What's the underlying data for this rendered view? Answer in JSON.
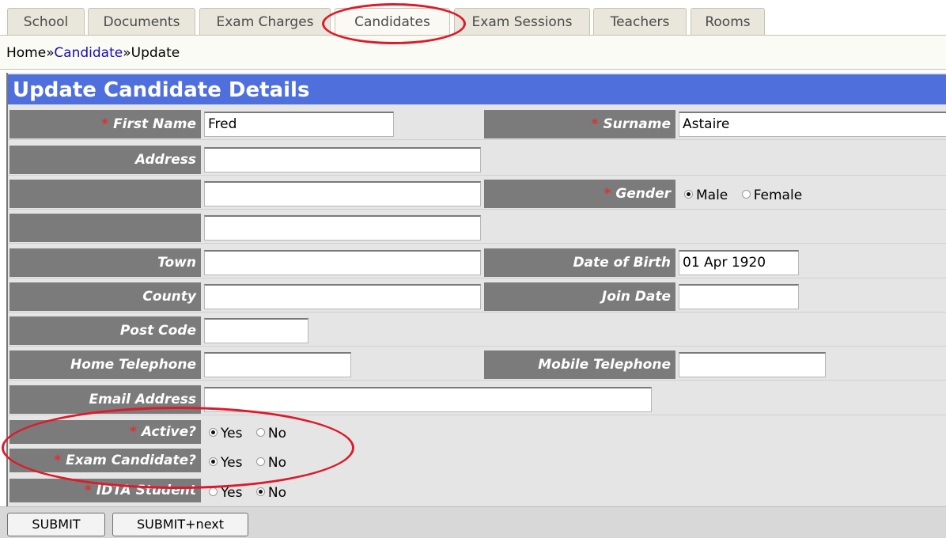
{
  "tabs": [
    {
      "label": "School"
    },
    {
      "label": "Documents"
    },
    {
      "label": "Exam Charges"
    },
    {
      "label": "Candidates",
      "active": true
    },
    {
      "label": "Exam Sessions"
    },
    {
      "label": "Teachers"
    },
    {
      "label": "Rooms"
    }
  ],
  "breadcrumb": {
    "home": "Home",
    "sep1": "»",
    "candidate": "Candidate",
    "sep2": "»",
    "update": "Update"
  },
  "form": {
    "title": "Update Candidate Details",
    "required_mark": "*",
    "first_name": {
      "label": "First Name",
      "value": "Fred"
    },
    "surname": {
      "label": "Surname",
      "value": "Astaire"
    },
    "address": {
      "label": "Address",
      "line1": "",
      "line2": "",
      "line3": ""
    },
    "gender": {
      "label": "Gender",
      "options": [
        "Male",
        "Female"
      ],
      "selected": "Male"
    },
    "town": {
      "label": "Town",
      "value": ""
    },
    "date_of_birth": {
      "label": "Date of Birth",
      "value": "01 Apr 1920"
    },
    "county": {
      "label": "County",
      "value": ""
    },
    "join_date": {
      "label": "Join Date",
      "value": ""
    },
    "post_code": {
      "label": "Post Code",
      "value": ""
    },
    "home_telephone": {
      "label": "Home Telephone",
      "value": ""
    },
    "mobile_telephone": {
      "label": "Mobile Telephone",
      "value": ""
    },
    "email_address": {
      "label": "Email Address",
      "value": ""
    },
    "active": {
      "label": "Active?",
      "yes": "Yes",
      "no": "No",
      "selected": "Yes"
    },
    "exam_candidate": {
      "label": "Exam Candidate?",
      "yes": "Yes",
      "no": "No",
      "selected": "Yes"
    },
    "idta_student": {
      "label": "IDTA Student",
      "yes": "Yes",
      "no": "No",
      "selected": "No"
    }
  },
  "buttons": {
    "submit": "SUBMIT",
    "submit_next": "SUBMIT+next"
  },
  "colors": {
    "title_bar": "#4f6fdc",
    "label_bg": "#7b7b7b",
    "required": "#e03030",
    "annotation": "#dd1a2a"
  }
}
